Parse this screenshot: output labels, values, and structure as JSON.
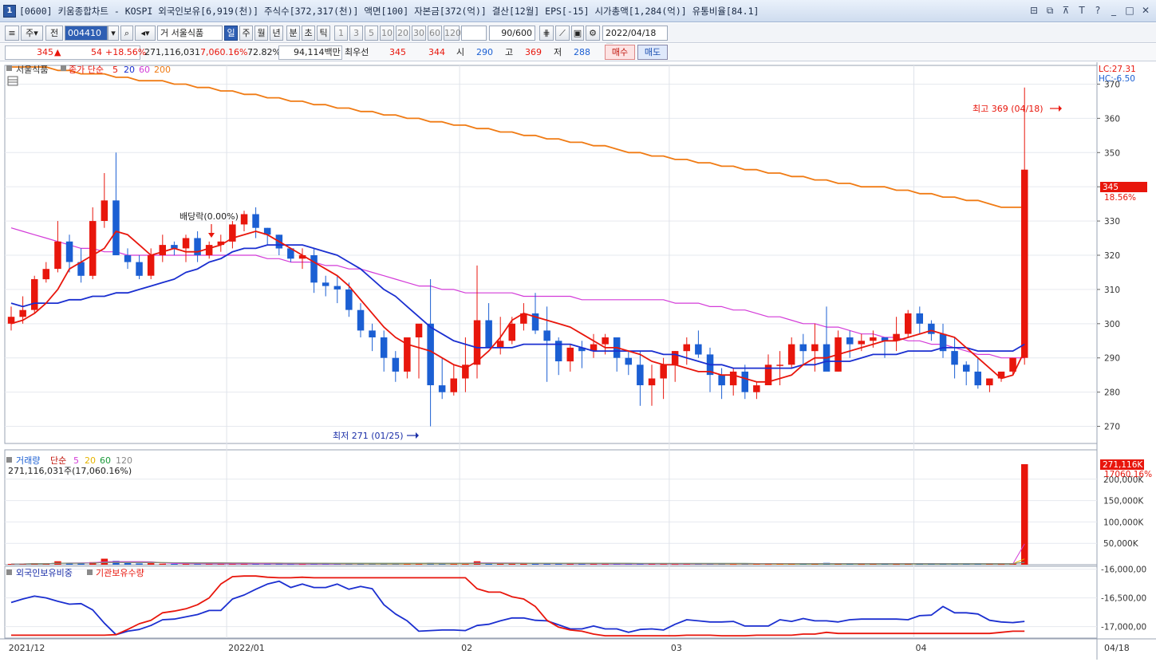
{
  "window": {
    "screen_id": "1",
    "title": "[0600] 키움종합차트 - KOSPI 외국인보유[6,919(천)] 주식수[372,317(천)] 액면[100] 자본금[372(억)] 결산[12월] EPS[-15] 시가총액[1,284(억)] 유통비율[84.1]",
    "controls": [
      "⊟",
      "⧉",
      "⊼",
      "T",
      "?",
      "_",
      "□",
      "✕"
    ]
  },
  "toolbar": {
    "mode_label": "주",
    "jeon_label": "전",
    "code_value": "004410",
    "stock_name": "서울식품",
    "prefix_label": "거",
    "periods": [
      "일",
      "주",
      "월",
      "년",
      "분",
      "초",
      "틱"
    ],
    "active_period": "일",
    "intervals": [
      "1",
      "3",
      "5",
      "10",
      "20",
      "30",
      "60",
      "120"
    ],
    "count_value": "90",
    "count_max": "/600",
    "date_value": "2022/04/18"
  },
  "infobar": {
    "price": "345",
    "arrow": "▲",
    "change": "54",
    "change_rate": "+18.56%",
    "volume": "271,116,031",
    "volume_rate": "7,060.16%",
    "turnover": "72.82%",
    "amount": "94,114백만",
    "best_ask_label": "최우선",
    "best_ask": "345",
    "best_bid": "344",
    "open_label": "시",
    "open": "290",
    "high_label": "고",
    "high": "369",
    "low_label": "저",
    "low": "288",
    "buy_label": "매수",
    "sell_label": "매도"
  },
  "price_panel": {
    "legend_name": "서울식품",
    "legend_ma": "종가 단순",
    "ma_periods": [
      "5",
      "20",
      "60",
      "200"
    ],
    "lc_label": "LC:27.31",
    "hc_label": "HC:-6.50",
    "current_tag": "345",
    "current_rate": "18.56%",
    "high_annotation": "최고 369 (04/18)",
    "low_annotation": "최저 271 (01/25)",
    "dividend_annotation": "배당락(0.00%)"
  },
  "volume_panel": {
    "legend_name": "거래량",
    "legend_ma": "단순",
    "ma_periods": [
      "5",
      "20",
      "60",
      "120"
    ],
    "readout": "271,116,031주(17,060.16%)",
    "current_tag": "271,116K",
    "current_rate": "17060.16%"
  },
  "foreign_panel": {
    "legend_a": "외국인보유비중",
    "legend_b": "기관보유수량"
  },
  "colors": {
    "up": "#e8160c",
    "down": "#1b5fd3",
    "ma5": "#e8160c",
    "ma20": "#1a2fd0",
    "ma60": "#d33bd8",
    "ma200": "#f07b14",
    "ma120": "#888888",
    "vma20": "#e6b400",
    "vma60": "#1a9a3a"
  },
  "chart_data": {
    "type": "candlestick",
    "price_axis": {
      "min": 265,
      "max": 375,
      "ticks": [
        270,
        280,
        290,
        300,
        310,
        320,
        330,
        340,
        350,
        360,
        370
      ]
    },
    "volume_axis": {
      "max": 250000,
      "ticks": [
        "50,000K",
        "100,000K",
        "150,000K",
        "200,000K"
      ],
      "tick_values": [
        50000,
        100000,
        150000,
        200000
      ]
    },
    "foreign_axis": {
      "min": -17200,
      "max": -15950,
      "ticks": [
        "-16,000,00",
        "-16,500,00",
        "-17,000,00"
      ],
      "tick_values": [
        -16000,
        -16500,
        -17000
      ]
    },
    "date_labels": [
      {
        "i": 0,
        "label": "2021/12"
      },
      {
        "i": 19,
        "label": "2022/01"
      },
      {
        "i": 39,
        "label": "02"
      },
      {
        "i": 57,
        "label": "03"
      },
      {
        "i": 78,
        "label": "04"
      }
    ],
    "last_date_label": "04/18",
    "candles": [
      [
        300,
        305,
        298,
        302
      ],
      [
        302,
        308,
        300,
        304
      ],
      [
        304,
        314,
        303,
        313
      ],
      [
        313,
        318,
        312,
        316
      ],
      [
        316,
        330,
        315,
        324
      ],
      [
        324,
        326,
        315,
        318
      ],
      [
        318,
        322,
        312,
        314
      ],
      [
        314,
        334,
        313,
        330
      ],
      [
        330,
        344,
        328,
        336
      ],
      [
        336,
        350,
        322,
        320
      ],
      [
        320,
        322,
        316,
        318
      ],
      [
        318,
        320,
        313,
        314
      ],
      [
        314,
        322,
        313,
        320
      ],
      [
        320,
        326,
        318,
        323
      ],
      [
        323,
        324,
        320,
        322
      ],
      [
        322,
        326,
        318,
        325
      ],
      [
        325,
        327,
        318,
        320
      ],
      [
        320,
        324,
        319,
        323
      ],
      [
        323,
        326,
        321,
        324
      ],
      [
        324,
        330,
        322,
        329
      ],
      [
        329,
        333,
        327,
        332
      ],
      [
        332,
        334,
        325,
        328
      ],
      [
        328,
        328,
        323,
        326
      ],
      [
        326,
        326,
        320,
        322
      ],
      [
        322,
        322,
        318,
        319
      ],
      [
        319,
        322,
        316,
        320
      ],
      [
        320,
        322,
        309,
        312
      ],
      [
        312,
        314,
        308,
        311
      ],
      [
        311,
        314,
        306,
        310
      ],
      [
        310,
        312,
        302,
        304
      ],
      [
        304,
        306,
        296,
        298
      ],
      [
        298,
        300,
        292,
        296
      ],
      [
        296,
        298,
        286,
        290
      ],
      [
        290,
        292,
        283,
        286
      ],
      [
        286,
        296,
        284,
        296
      ],
      [
        296,
        298,
        284,
        300
      ],
      [
        300,
        313,
        270,
        282
      ],
      [
        282,
        290,
        278,
        280
      ],
      [
        280,
        288,
        279,
        284
      ],
      [
        284,
        296,
        280,
        288
      ],
      [
        288,
        317,
        284,
        301
      ],
      [
        301,
        306,
        294,
        293
      ],
      [
        293,
        302,
        291,
        295
      ],
      [
        295,
        302,
        294,
        300
      ],
      [
        300,
        306,
        298,
        303
      ],
      [
        303,
        309,
        297,
        298
      ],
      [
        298,
        305,
        283,
        295
      ],
      [
        295,
        296,
        285,
        289
      ],
      [
        289,
        294,
        286,
        293
      ],
      [
        293,
        295,
        287,
        292
      ],
      [
        292,
        297,
        290,
        294
      ],
      [
        294,
        297,
        291,
        296
      ],
      [
        296,
        296,
        286,
        290
      ],
      [
        290,
        292,
        285,
        288
      ],
      [
        288,
        292,
        276,
        282
      ],
      [
        282,
        288,
        276,
        284
      ],
      [
        284,
        290,
        278,
        288
      ],
      [
        288,
        292,
        283,
        292
      ],
      [
        292,
        296,
        288,
        294
      ],
      [
        294,
        298,
        290,
        291
      ],
      [
        291,
        293,
        280,
        285
      ],
      [
        285,
        287,
        278,
        282
      ],
      [
        282,
        287,
        279,
        286
      ],
      [
        286,
        288,
        278,
        280
      ],
      [
        280,
        283,
        278,
        282
      ],
      [
        282,
        291,
        282,
        288
      ],
      [
        288,
        292,
        282,
        288
      ],
      [
        288,
        296,
        287,
        294
      ],
      [
        294,
        297,
        288,
        292
      ],
      [
        292,
        300,
        286,
        294
      ],
      [
        294,
        305,
        287,
        286
      ],
      [
        286,
        298,
        286,
        296
      ],
      [
        296,
        298,
        290,
        294
      ],
      [
        294,
        297,
        292,
        295
      ],
      [
        295,
        298,
        293,
        296
      ],
      [
        296,
        296,
        290,
        295
      ],
      [
        295,
        302,
        292,
        297
      ],
      [
        297,
        304,
        296,
        303
      ],
      [
        303,
        305,
        297,
        300
      ],
      [
        300,
        301,
        295,
        297
      ],
      [
        297,
        300,
        290,
        292
      ],
      [
        292,
        296,
        284,
        288
      ],
      [
        288,
        289,
        282,
        286
      ],
      [
        286,
        290,
        281,
        282
      ],
      [
        282,
        284,
        280,
        284
      ],
      [
        284,
        285,
        283,
        286
      ],
      [
        286,
        290,
        285,
        290
      ],
      [
        290,
        369,
        288,
        345
      ]
    ],
    "ma5": [
      300,
      301,
      303,
      306,
      310,
      316,
      318,
      320,
      322,
      327,
      326,
      323,
      320,
      321,
      322,
      321,
      321,
      322,
      323,
      325,
      326,
      327,
      326,
      324,
      322,
      320,
      318,
      316,
      314,
      311,
      307,
      303,
      299,
      296,
      294,
      293,
      292,
      290,
      288,
      287,
      289,
      292,
      296,
      301,
      303,
      302,
      301,
      300,
      299,
      297,
      295,
      293,
      293,
      292,
      291,
      289,
      288,
      288,
      287,
      286,
      286,
      285,
      285,
      284,
      283,
      283,
      284,
      285,
      288,
      290,
      290,
      291,
      292,
      293,
      294,
      295,
      295,
      296,
      297,
      298,
      297,
      296,
      293,
      290,
      287,
      284,
      285,
      292
    ],
    "ma20": [
      306,
      305,
      306,
      306,
      306,
      307,
      307,
      308,
      308,
      309,
      309,
      310,
      311,
      312,
      313,
      315,
      316,
      318,
      319,
      321,
      322,
      322,
      323,
      323,
      323,
      323,
      322,
      321,
      320,
      318,
      316,
      313,
      310,
      308,
      305,
      302,
      299,
      297,
      295,
      294,
      293,
      293,
      293,
      293,
      294,
      294,
      294,
      294,
      294,
      293,
      292,
      292,
      292,
      292,
      292,
      292,
      291,
      291,
      290,
      289,
      288,
      288,
      287,
      287,
      287,
      287,
      287,
      287,
      288,
      288,
      289,
      289,
      289,
      290,
      291,
      291,
      291,
      292,
      292,
      292,
      293,
      293,
      293,
      292,
      292,
      292,
      292,
      294
    ],
    "ma60": [
      328,
      327,
      326,
      325,
      324,
      323,
      322,
      322,
      321,
      321,
      320,
      320,
      320,
      320,
      320,
      320,
      320,
      320,
      320,
      320,
      320,
      320,
      319,
      319,
      318,
      318,
      318,
      317,
      317,
      316,
      316,
      315,
      314,
      313,
      312,
      311,
      311,
      310,
      310,
      309,
      309,
      309,
      309,
      309,
      308,
      308,
      308,
      308,
      308,
      307,
      307,
      307,
      307,
      307,
      307,
      307,
      307,
      306,
      306,
      306,
      305,
      305,
      304,
      304,
      303,
      302,
      302,
      301,
      300,
      300,
      299,
      299,
      298,
      297,
      297,
      296,
      296,
      295,
      295,
      294,
      294,
      293,
      292,
      291,
      291,
      290,
      290,
      290
    ],
    "ma200": [
      375,
      375,
      375,
      375,
      374,
      374,
      373,
      373,
      373,
      372,
      372,
      371,
      371,
      371,
      370,
      370,
      369,
      369,
      368,
      368,
      367,
      367,
      366,
      366,
      365,
      365,
      364,
      364,
      363,
      363,
      362,
      362,
      361,
      361,
      360,
      360,
      359,
      359,
      358,
      358,
      357,
      357,
      356,
      356,
      355,
      355,
      354,
      354,
      353,
      353,
      352,
      352,
      351,
      350,
      350,
      349,
      349,
      348,
      348,
      347,
      347,
      346,
      346,
      345,
      345,
      344,
      344,
      343,
      343,
      342,
      342,
      341,
      341,
      340,
      340,
      340,
      339,
      339,
      338,
      338,
      337,
      337,
      336,
      336,
      335,
      334,
      334,
      334
    ],
    "volume": [
      1800,
      2000,
      3500,
      2500,
      8000,
      4000,
      3000,
      6000,
      14000,
      9000,
      4000,
      3000,
      3500,
      2500,
      2000,
      2200,
      2000,
      1800,
      1900,
      2100,
      2000,
      2200,
      1800,
      2000,
      1700,
      1600,
      2400,
      1900,
      1800,
      2300,
      2600,
      2300,
      2800,
      2500,
      3000,
      2600,
      4500,
      3200,
      2800,
      3100,
      8000,
      3500,
      2600,
      2400,
      2300,
      2600,
      3100,
      2400,
      2000,
      1900,
      1800,
      1900,
      2100,
      1900,
      2200,
      2000,
      1800,
      1700,
      1900,
      1800,
      2100,
      1900,
      1700,
      2000,
      1800,
      1700,
      1900,
      1800,
      2000,
      2100,
      4200,
      2000,
      1800,
      1700,
      1900,
      1800,
      1700,
      1800,
      2000,
      1900,
      1800,
      2000,
      1900,
      2100,
      1800,
      1700,
      2200,
      235000
    ],
    "foreign_ratio": [
      -16580,
      -16520,
      -16470,
      -16500,
      -16560,
      -16610,
      -16600,
      -16710,
      -16940,
      -17140,
      -17080,
      -17050,
      -16980,
      -16880,
      -16870,
      -16830,
      -16790,
      -16720,
      -16720,
      -16520,
      -16450,
      -16350,
      -16260,
      -16210,
      -16320,
      -16260,
      -16320,
      -16320,
      -16260,
      -16350,
      -16300,
      -16340,
      -16620,
      -16780,
      -16900,
      -17080,
      -17070,
      -17060,
      -17060,
      -17070,
      -16980,
      -16960,
      -16900,
      -16850,
      -16850,
      -16890,
      -16900,
      -16970,
      -17040,
      -17040,
      -16990,
      -17040,
      -17040,
      -17100,
      -17050,
      -17040,
      -17060,
      -16960,
      -16880,
      -16900,
      -16920,
      -16920,
      -16910,
      -16990,
      -16990,
      -16990,
      -16880,
      -16910,
      -16860,
      -16900,
      -16900,
      -16920,
      -16880,
      -16870,
      -16870,
      -16870,
      -16870,
      -16880,
      -16810,
      -16800,
      -16650,
      -16760,
      -16760,
      -16780,
      -16890,
      -16920,
      -16930,
      -16910
    ],
    "institution_qty": [
      -17150,
      -17150,
      -17150,
      -17150,
      -17150,
      -17150,
      -17150,
      -17150,
      -17150,
      -17140,
      -17050,
      -16950,
      -16890,
      -16760,
      -16730,
      -16690,
      -16620,
      -16500,
      -16260,
      -16130,
      -16120,
      -16120,
      -16140,
      -16150,
      -16150,
      -16140,
      -16150,
      -16150,
      -16150,
      -16150,
      -16150,
      -16150,
      -16150,
      -16150,
      -16150,
      -16150,
      -16150,
      -16150,
      -16150,
      -16150,
      -16340,
      -16400,
      -16400,
      -16480,
      -16520,
      -16650,
      -16890,
      -17010,
      -17060,
      -17080,
      -17130,
      -17160,
      -17160,
      -17160,
      -17160,
      -17160,
      -17160,
      -17160,
      -17150,
      -17150,
      -17150,
      -17160,
      -17160,
      -17160,
      -17150,
      -17150,
      -17150,
      -17150,
      -17130,
      -17130,
      -17100,
      -17120,
      -17120,
      -17120,
      -17120,
      -17120,
      -17120,
      -17120,
      -17120,
      -17120,
      -17120,
      -17120,
      -17120,
      -17120,
      -17120,
      -17100,
      -17080,
      -17080
    ]
  }
}
